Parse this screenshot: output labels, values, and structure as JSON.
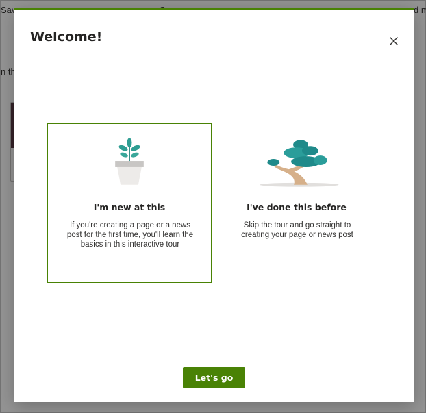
{
  "background": {
    "top_left_text": "Save",
    "top_middle_text": "S",
    "top_right_text": "d m",
    "left_text": "n th"
  },
  "dialog": {
    "title": "Welcome!",
    "close_icon": "close-icon",
    "accent_color": "#498205"
  },
  "options": [
    {
      "title": "I'm new at this",
      "description": "If you're creating a page or a news post for the first time, you'll learn the basics in this interactive tour",
      "icon": "seedling-pot-icon",
      "selected": true
    },
    {
      "title": "I've done this before",
      "description": "Skip the tour and go straight to creating your page or news post",
      "icon": "bonsai-tree-icon",
      "selected": false
    }
  ],
  "footer": {
    "primary_label": "Let's go"
  }
}
